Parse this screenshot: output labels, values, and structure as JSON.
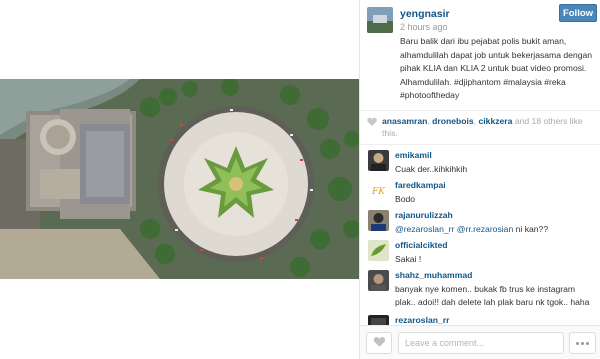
{
  "post": {
    "photo_icon": "aerial-photo-mosque-roundabout"
  },
  "author": {
    "username": "yengnasir",
    "timestamp": "2 hours ago",
    "avatar_icon": "user-avatar"
  },
  "follow_button": {
    "label": "Follow",
    "color": "#4b86b8"
  },
  "caption": "Baru balik dari ibu pejabat polis bukit aman, alhamdulilah dapat job untuk bekerjasama dengan pihak KLIA dan KLIA 2 untuk buat video promosi. Alhamdulilah. #djiphantom #malaysia #reka #photooftheday",
  "likes": {
    "icon": "heart-icon",
    "users": [
      "anasamran",
      "dronebois",
      "cikkzera"
    ],
    "others_text": "and 18 others like this."
  },
  "comments": [
    {
      "user": "emikamil",
      "text": "Cuak der..kihkihkih"
    },
    {
      "user": "faredkampai",
      "text": "Bodo"
    },
    {
      "user": "rajanurulizzah",
      "mentions": "@rezaroslan_rr @rr.rezarosian",
      "text": " ni kan??"
    },
    {
      "user": "officialcikted",
      "text": "Sakai !"
    },
    {
      "user": "shahz_muhammad",
      "text": "banyak nye komen.. bukak fb trus ke instagram plak.. adoi!! dah delete lah plak baru nk tgok.. haha"
    },
    {
      "user": "rezaroslan_rr",
      "text": ""
    }
  ],
  "footer": {
    "comment_placeholder": "Leave a comment...",
    "like_icon": "heart-icon",
    "more_icon": "more-options-icon"
  },
  "colors": {
    "username": "#125688",
    "border": "#e6e6e6"
  }
}
